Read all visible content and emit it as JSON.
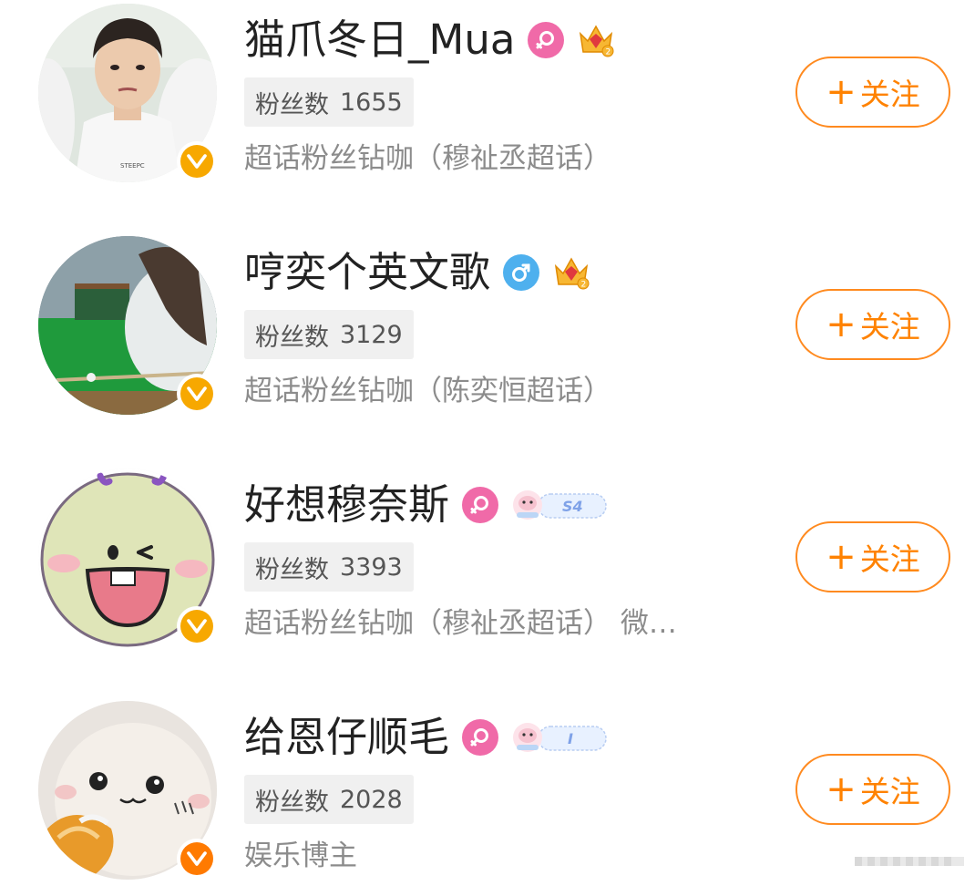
{
  "users": [
    {
      "name": "猫爪冬日_Mua",
      "gender": "female",
      "badge": "crown",
      "fans_label": "粉丝数",
      "fans_count": "1655",
      "description": "超话粉丝钻咖（穆祉丞超话）",
      "follow_label": "关注",
      "follow_plus": "+",
      "verify_color": "#f7a800"
    },
    {
      "name": "哼奕个英文歌",
      "gender": "male",
      "badge": "crown",
      "fans_label": "粉丝数",
      "fans_count": "3129",
      "description": "超话粉丝钻咖（陈奕恒超话）",
      "follow_label": "关注",
      "follow_plus": "+",
      "verify_color": "#f7a800"
    },
    {
      "name": "好想穆奈斯",
      "gender": "female",
      "badge": "level",
      "badge_text": "S4",
      "fans_label": "粉丝数",
      "fans_count": "3393",
      "description": "超话粉丝钻咖（穆祉丞超话） 微…",
      "follow_label": "关注",
      "follow_plus": "+",
      "verify_color": "#f7a800"
    },
    {
      "name": "给恩仔顺毛",
      "gender": "female",
      "badge": "level",
      "badge_text": "I",
      "fans_label": "粉丝数",
      "fans_count": "2028",
      "description": "娱乐博主",
      "follow_label": "关注",
      "follow_plus": "+",
      "verify_color": "#ff7a00"
    }
  ],
  "colors": {
    "accent": "#ff8200",
    "female": "#f06aa8",
    "male": "#4eb0ee",
    "chip_bg": "#f0f0f0",
    "desc_text": "#8c8c8c"
  }
}
